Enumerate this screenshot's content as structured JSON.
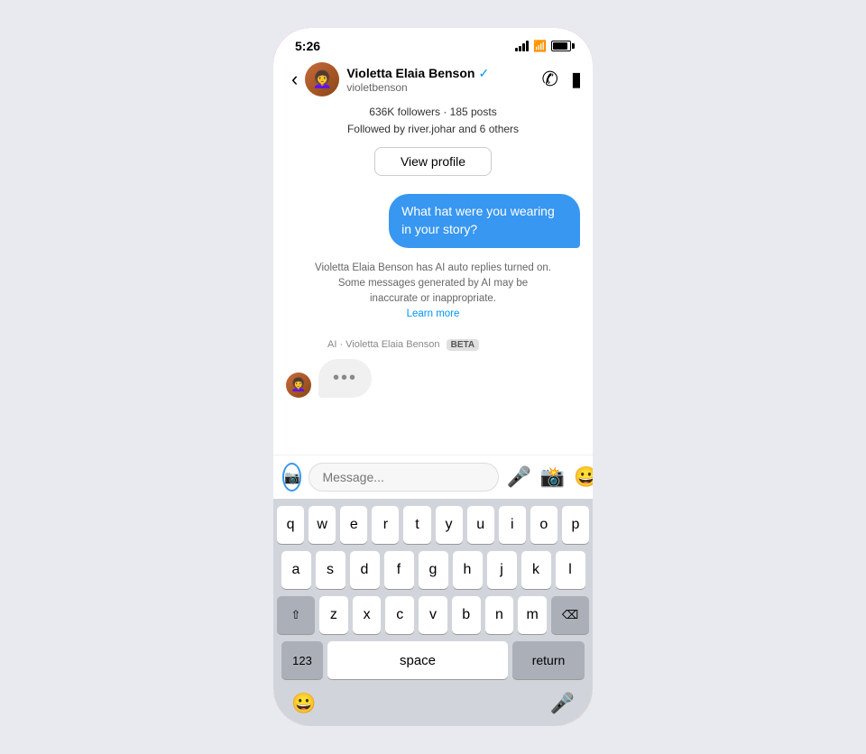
{
  "status": {
    "time": "5:26"
  },
  "header": {
    "username": "violetbenson",
    "display_name": "Violetta Elaia Benson",
    "followers": "636K followers · 185 posts",
    "followed_by": "Followed by river.johar and 6 others",
    "view_profile_label": "View profile"
  },
  "messages": [
    {
      "type": "outgoing",
      "text": "What hat were you wearing in your story?"
    }
  ],
  "ai_notice": {
    "line1": "Violetta Elaia Benson has AI auto replies turned on.",
    "line2": "Some messages generated by AI may be",
    "line3": "inaccurate or inappropriate.",
    "learn_more": "Learn more"
  },
  "ai_label": {
    "text": "AI · Violetta Elaia Benson",
    "badge": "BETA"
  },
  "input": {
    "placeholder": "Message..."
  },
  "keyboard": {
    "rows": [
      [
        "q",
        "w",
        "e",
        "r",
        "t",
        "y",
        "u",
        "i",
        "o",
        "p"
      ],
      [
        "a",
        "s",
        "d",
        "f",
        "g",
        "h",
        "j",
        "k",
        "l"
      ],
      [
        "z",
        "x",
        "c",
        "v",
        "b",
        "n",
        "m"
      ]
    ],
    "space_label": "space",
    "return_label": "return",
    "num_label": "123"
  }
}
